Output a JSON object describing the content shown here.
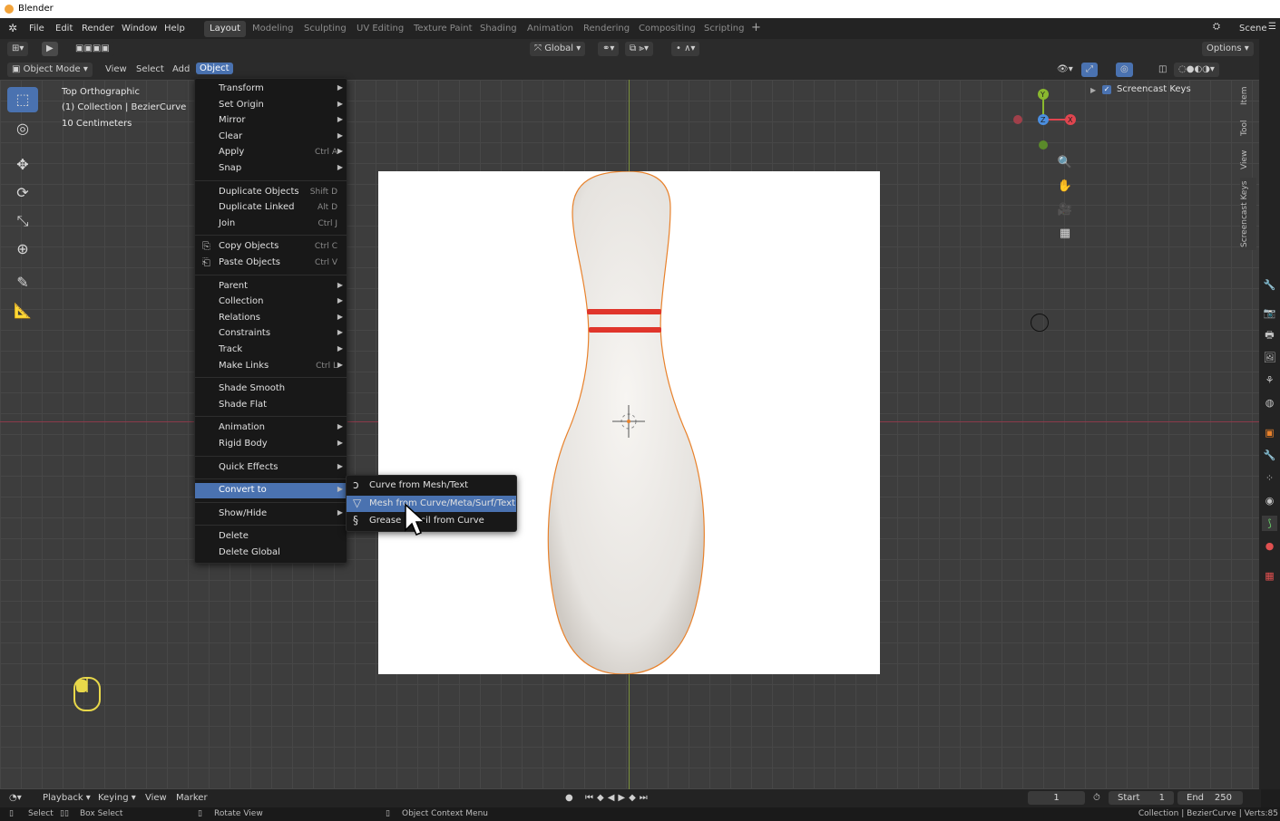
{
  "app": {
    "title": "Blender"
  },
  "menubar": {
    "items": [
      "File",
      "Edit",
      "Render",
      "Window",
      "Help"
    ]
  },
  "workspaces": [
    "Layout",
    "Modeling",
    "Sculpting",
    "UV Editing",
    "Texture Paint",
    "Shading",
    "Animation",
    "Rendering",
    "Compositing",
    "Scripting"
  ],
  "workspace_active": "Layout",
  "scene": "Scene",
  "toolheader": {
    "orientation": "Global",
    "options": "Options"
  },
  "viewheader": {
    "mode": "Object Mode",
    "menus": [
      "View",
      "Select",
      "Add",
      "Object"
    ],
    "active_menu": "Object"
  },
  "overlay": {
    "view_name": "Top Orthographic",
    "collection_info": "(1) Collection | BezierCurve",
    "scale": "10 Centimeters"
  },
  "outliner_panel": {
    "item": "Screencast Keys",
    "checked": true
  },
  "side_tabs": [
    "Item",
    "Tool",
    "View",
    "Screencast Keys"
  ],
  "object_menu": [
    {
      "label": "Transform",
      "submenu": true
    },
    {
      "label": "Set Origin",
      "submenu": true
    },
    {
      "label": "Mirror",
      "submenu": true
    },
    {
      "label": "Clear",
      "submenu": true
    },
    {
      "label": "Apply",
      "shortcut": "Ctrl A",
      "submenu": true
    },
    {
      "label": "Snap",
      "submenu": true
    },
    {
      "sep": true
    },
    {
      "label": "Duplicate Objects",
      "shortcut": "Shift D"
    },
    {
      "label": "Duplicate Linked",
      "shortcut": "Alt D"
    },
    {
      "label": "Join",
      "shortcut": "Ctrl J"
    },
    {
      "sep": true
    },
    {
      "label": "Copy Objects",
      "shortcut": "Ctrl C",
      "icon": "copy-icon"
    },
    {
      "label": "Paste Objects",
      "shortcut": "Ctrl V",
      "icon": "paste-icon"
    },
    {
      "sep": true
    },
    {
      "label": "Parent",
      "submenu": true
    },
    {
      "label": "Collection",
      "submenu": true
    },
    {
      "label": "Relations",
      "submenu": true
    },
    {
      "label": "Constraints",
      "submenu": true
    },
    {
      "label": "Track",
      "submenu": true
    },
    {
      "label": "Make Links",
      "shortcut": "Ctrl L",
      "submenu": true
    },
    {
      "sep": true
    },
    {
      "label": "Shade Smooth"
    },
    {
      "label": "Shade Flat"
    },
    {
      "sep": true
    },
    {
      "label": "Animation",
      "submenu": true
    },
    {
      "label": "Rigid Body",
      "submenu": true
    },
    {
      "sep": true
    },
    {
      "label": "Quick Effects",
      "submenu": true
    },
    {
      "sep": true
    },
    {
      "label": "Convert to",
      "submenu": true,
      "highlighted": true
    },
    {
      "sep": true
    },
    {
      "label": "Show/Hide",
      "submenu": true
    },
    {
      "sep": true
    },
    {
      "label": "Delete"
    },
    {
      "label": "Delete Global"
    }
  ],
  "convert_submenu": [
    {
      "label": "Curve from Mesh/Text",
      "icon": "curve-icon"
    },
    {
      "label": "Mesh from Curve/Meta/Surf/Text",
      "icon": "mesh-icon",
      "highlighted": true
    },
    {
      "label": "Grease Pencil from Curve",
      "icon": "grease-pencil-icon"
    }
  ],
  "timeline": {
    "menus": [
      "Playback",
      "Keying",
      "View",
      "Marker"
    ],
    "current_frame": "1",
    "start_label": "Start",
    "start": "1",
    "end_label": "End",
    "end": "250"
  },
  "statusbar": {
    "left": [
      "Select",
      "Box Select",
      "Rotate View",
      "Object Context Menu"
    ],
    "right": "Collection | BezierCurve | Verts:85"
  },
  "colors": {
    "accent": "#4a72b0",
    "pin_stripe": "#e0352b",
    "outline": "#e8822c"
  }
}
